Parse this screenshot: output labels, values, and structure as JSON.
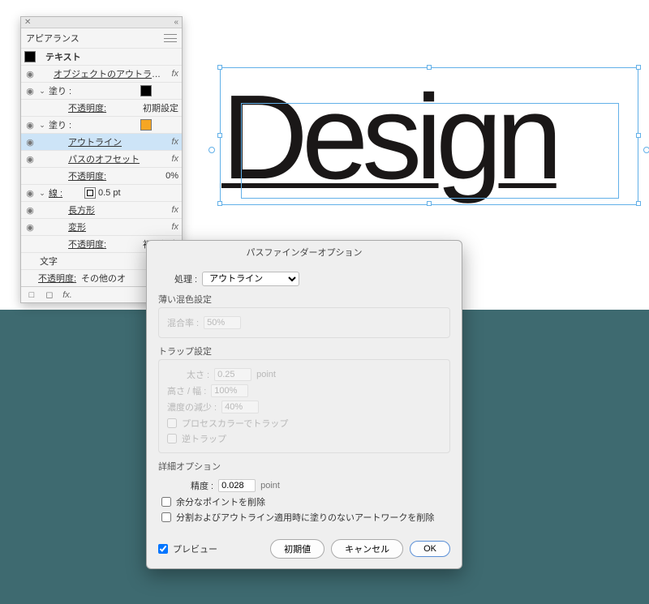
{
  "canvas_text": "Design",
  "appearance": {
    "tab_label": "アピアランス",
    "item_label": "テキスト",
    "object_outline": "オブジェクトのアウトライン",
    "fill_label": "塗り :",
    "opacity_label": "不透明度:",
    "opacity_default": "初期設定",
    "outline_label": "アウトライン",
    "offset_label": "パスのオフセット",
    "opacity_zero": "0%",
    "stroke_label": "線 :",
    "stroke_weight": "0.5 pt",
    "rect_label": "長方形",
    "transform_label": "変形",
    "text_label": "文字",
    "other_label": "その他のオ"
  },
  "dialog": {
    "title": "パスファインダーオプション",
    "process_label": "処理 :",
    "process_value": "アウトライン",
    "soft_mix_title": "薄い混色設定",
    "mix_rate_label": "混合率 :",
    "mix_rate_value": "50%",
    "trap_title": "トラップ設定",
    "thickness_label": "太さ :",
    "thickness_value": "0.25",
    "height_label": "高さ / 幅 :",
    "height_value": "100%",
    "reduce_label": "濃度の減少 :",
    "reduce_value": "40%",
    "process_color_trap": "プロセスカラーでトラップ",
    "reverse_trap": "逆トラップ",
    "advanced_title": "詳細オプション",
    "precision_label": "精度 :",
    "precision_value": "0.028",
    "point_unit": "point",
    "remove_extra": "余分なポイントを削除",
    "remove_unpainted": "分割およびアウトライン適用時に塗りのないアートワークを削除",
    "preview": "プレビュー",
    "defaults": "初期値",
    "cancel": "キャンセル",
    "ok": "OK"
  }
}
